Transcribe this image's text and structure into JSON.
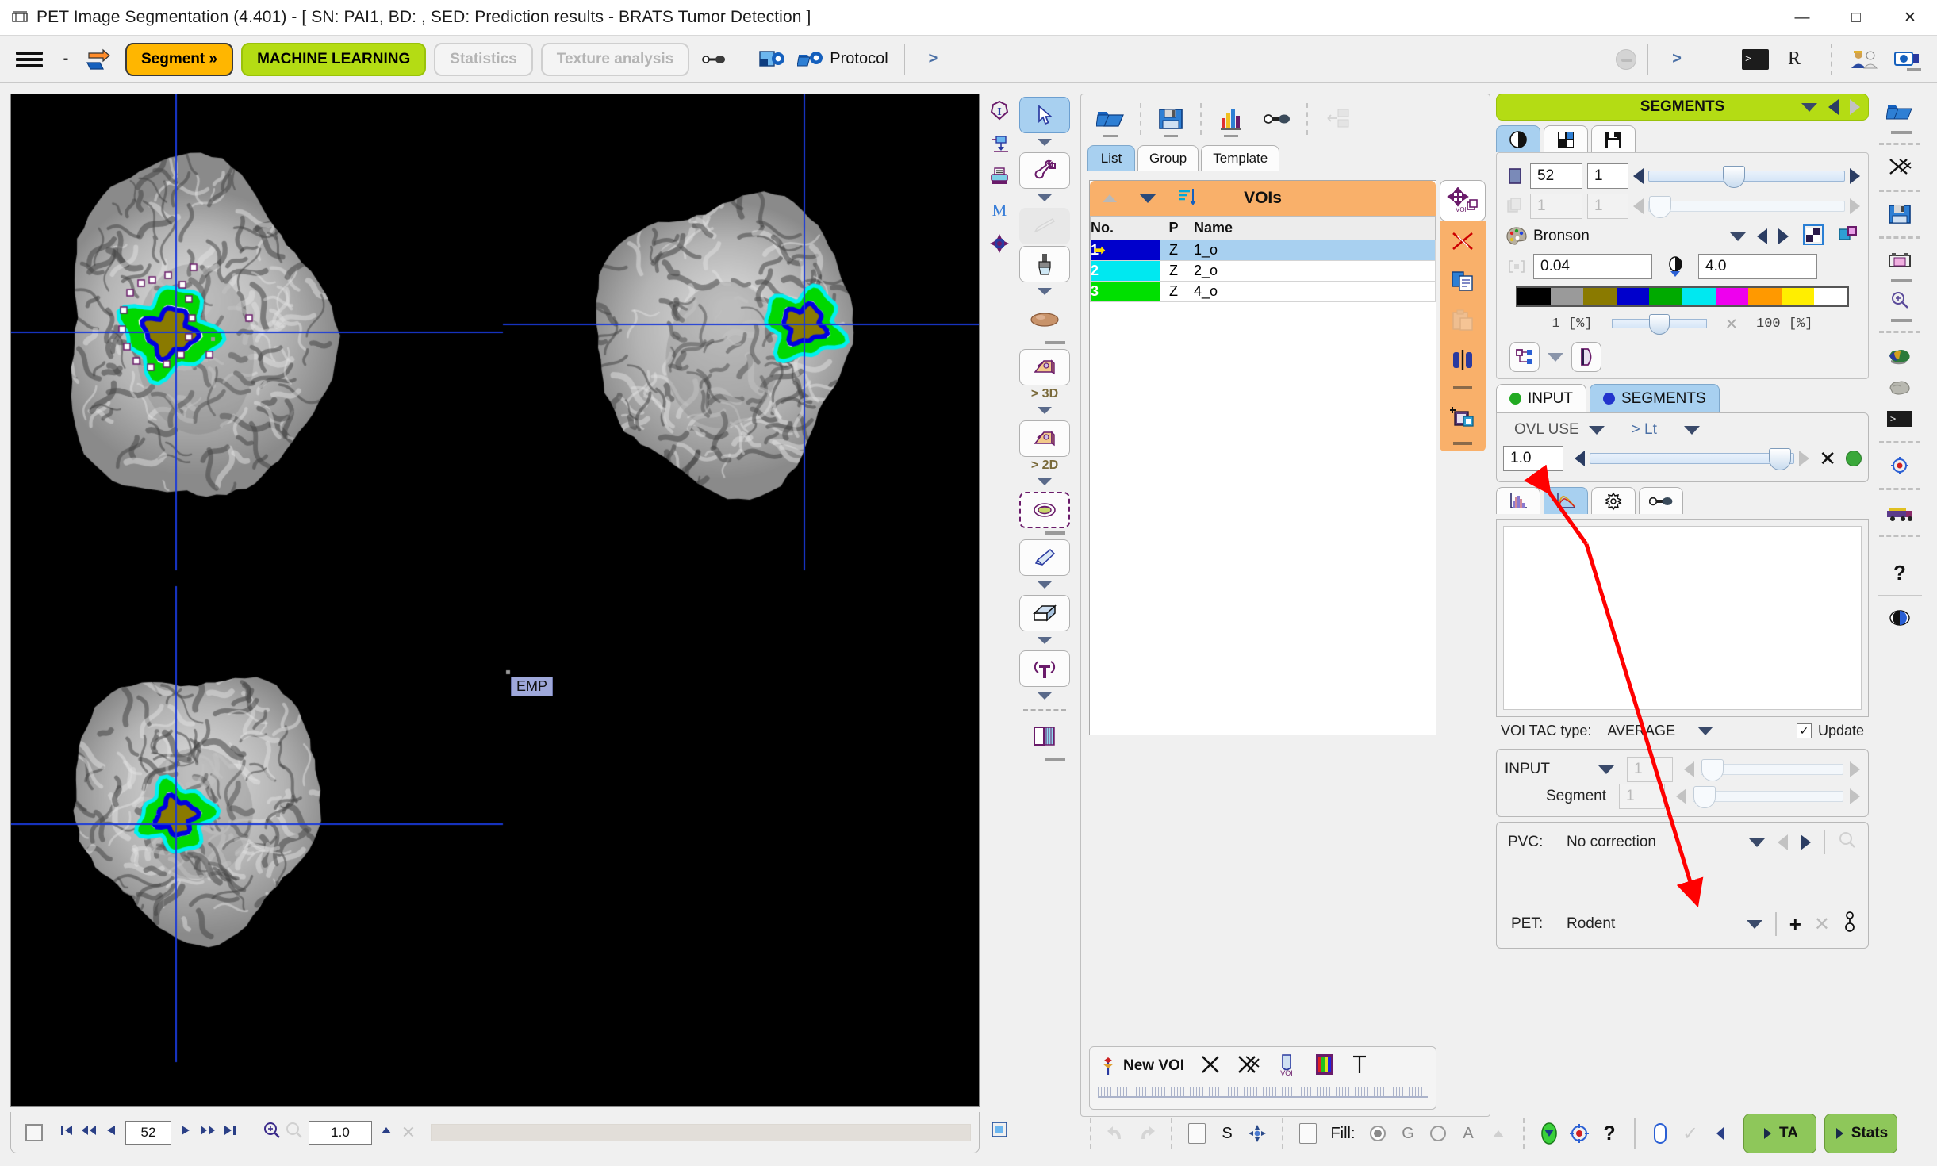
{
  "window": {
    "title": "PET Image Segmentation (4.401) - [ SN: PAI1, BD: , SED: Prediction results - BRATS Tumor Detection ]",
    "minimize": "—",
    "maximize": "□",
    "close": "✕"
  },
  "toolbar": {
    "menu_icon": "hamburger-icon",
    "minus_label": "-",
    "open_icon": "open-arrow-icon",
    "segment_label": "Segment »",
    "machine_learning_label": "MACHINE LEARNING",
    "statistics_label": "Statistics",
    "texture_label": "Texture analysis",
    "settings_icon": "wrench-slider-icon",
    "protocol_label": "Protocol",
    "chevron_label": ">",
    "terminal_icon": "terminal-icon",
    "r_label": "R",
    "users_icon": "users-icon",
    "camera_icon": "camera-icon"
  },
  "viewer": {
    "slice_value": "52",
    "zoom_value": "1.0",
    "emp_label": "EMP",
    "nav": {
      "first": "⏮",
      "fast_back": "⏪",
      "back": "◀",
      "forward": "▶",
      "fast_fwd": "⏩",
      "last": "⏭"
    }
  },
  "palette": {
    "label_3d": "> 3D",
    "label_2d": "> 2D",
    "tools": [
      "pointer-tool",
      "wrench-tool",
      "pencil-disabled-tool",
      "brush-tool",
      "blob-tool",
      "paint-3d-tool",
      "paint-2d-tool",
      "ellipse-select-tool",
      "eraser-tool",
      "cube-tool",
      "split-tool",
      "page-tool"
    ]
  },
  "voi_panel": {
    "tabs": [
      {
        "label": "List",
        "active": true
      },
      {
        "label": "Group",
        "active": false
      },
      {
        "label": "Template",
        "active": false
      }
    ],
    "toolbar_icons": [
      "open-folder-icon",
      "save-disk-icon",
      "bar-chart-icon",
      "wrench-slider-icon",
      "transfer-disabled-icon"
    ],
    "list_title": "VOIs",
    "columns": [
      "No.",
      "P",
      "Name"
    ],
    "rows": [
      {
        "no": "1",
        "p": "Z",
        "name": "1_o",
        "color": "#0000cc",
        "selected": true
      },
      {
        "no": "2",
        "p": "Z",
        "name": "2_o",
        "color": "#00e8f0",
        "selected": false
      },
      {
        "no": "3",
        "p": "Z",
        "name": "4_o",
        "color": "#00e000",
        "selected": false
      }
    ],
    "side_icons": [
      "move-voi-icon",
      "delete-cross-icon",
      "copy-icon",
      "paste-disabled-icon",
      "mirror-icon",
      "add-clipboard-icon"
    ],
    "new_voi_label": "New VOI",
    "bottom_icons": [
      "delete-x-icon",
      "delete-all-icon",
      "voi-copy-icon",
      "colorbar-icon",
      "text-icon"
    ]
  },
  "segments": {
    "header_title": "SEGMENTS",
    "tabs": [
      "contrast-tab",
      "layout-tab",
      "save-tab"
    ],
    "slice_field": "52",
    "slice_field2": "1",
    "frame_field": "1",
    "frame_field2": "1",
    "palette_name": "Bronson",
    "min_value": "0.04",
    "max_value": "4.0",
    "colorbar": [
      "#000000",
      "#9a9a9a",
      "#8a7a00",
      "#0000cc",
      "#00aa00",
      "#00e8f0",
      "#ee00ee",
      "#ff9900",
      "#ffee00",
      "#ffffff"
    ],
    "pct_min": "1  [%]",
    "pct_max": "100  [%]"
  },
  "input_segments": {
    "tabs": [
      {
        "label": "INPUT",
        "color": "#22aa22",
        "active": false
      },
      {
        "label": "SEGMENTS",
        "color": "#2233cc",
        "active": true
      }
    ],
    "ovl_label": "OVL USE",
    "lt_label": "> Lt",
    "value": "1.0"
  },
  "plot": {
    "tabs": [
      "histogram-tab",
      "tac-curve-tab",
      "settings-tab",
      "wrench-tab"
    ],
    "tac_type_label": "VOI TAC type:",
    "tac_type_value": "AVERAGE",
    "update_label": "Update",
    "update_checked": true
  },
  "input_seg_sliders": {
    "input_label": "INPUT",
    "input_value": "1",
    "segment_label": "Segment",
    "segment_value": "1"
  },
  "pvc": {
    "pvc_label": "PVC:",
    "pvc_value": "No correction",
    "pet_label": "PET:",
    "pet_value": "Rodent"
  },
  "bottom_bar": {
    "undo_icon": "undo-icon",
    "redo_icon": "redo-icon",
    "s_label": "S",
    "fill_label": "Fill:",
    "g_label": "G",
    "a_label": "A",
    "help_label": "?",
    "ta_label": "TA",
    "stats_label": "Stats"
  },
  "far_icons": [
    "open-folder-icon",
    "scissors-icon",
    "save-disk-icon",
    "print-icon",
    "zoom-in-icon",
    "brain-color-icon",
    "brain-gray-icon",
    "terminal-icon",
    "target-icon",
    "truck-icon",
    "help-icon",
    "contrast-icon"
  ]
}
